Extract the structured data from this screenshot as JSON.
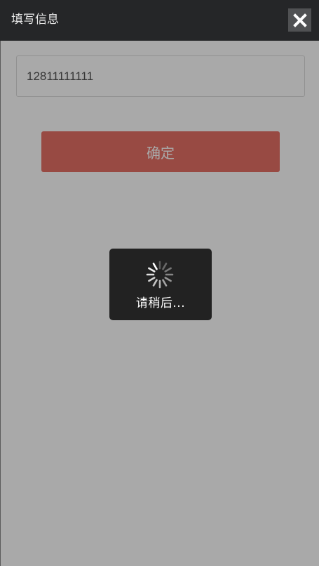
{
  "header": {
    "title": "填写信息",
    "close_icon": "close-icon"
  },
  "form": {
    "phone_value": "12811111111",
    "confirm_label": "确定"
  },
  "loading": {
    "text": "请稍后...",
    "icon": "spinner-icon"
  },
  "colors": {
    "header_bg": "#252628",
    "confirm_bg": "#e0564a",
    "toast_bg": "#222222"
  }
}
